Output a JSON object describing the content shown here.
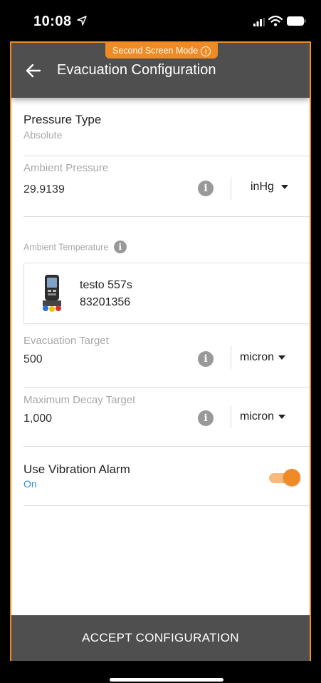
{
  "status_bar": {
    "time": "10:08"
  },
  "header": {
    "mode_badge": "Second Screen Mode",
    "title": "Evacuation Configuration"
  },
  "pressure_type": {
    "label": "Pressure Type",
    "value": "Absolute"
  },
  "ambient_pressure": {
    "label": "Ambient Pressure",
    "value": "29.9139",
    "unit": "inHg"
  },
  "ambient_temperature": {
    "label": "Ambient Temperature"
  },
  "device": {
    "name": "testo 557s",
    "serial": "83201356"
  },
  "evacuation_target": {
    "label": "Evacuation Target",
    "value": "500",
    "unit": "micron"
  },
  "maximum_decay_target": {
    "label": "Maximum Decay Target",
    "value": "1,000",
    "unit": "micron"
  },
  "vibration_alarm": {
    "label": "Use Vibration Alarm",
    "state": "On",
    "enabled": true
  },
  "footer": {
    "accept_label": "ACCEPT CONFIGURATION"
  },
  "colors": {
    "accent": "#f08a24",
    "appbar": "#4f4f4f",
    "on_text": "#3a8fc8"
  }
}
